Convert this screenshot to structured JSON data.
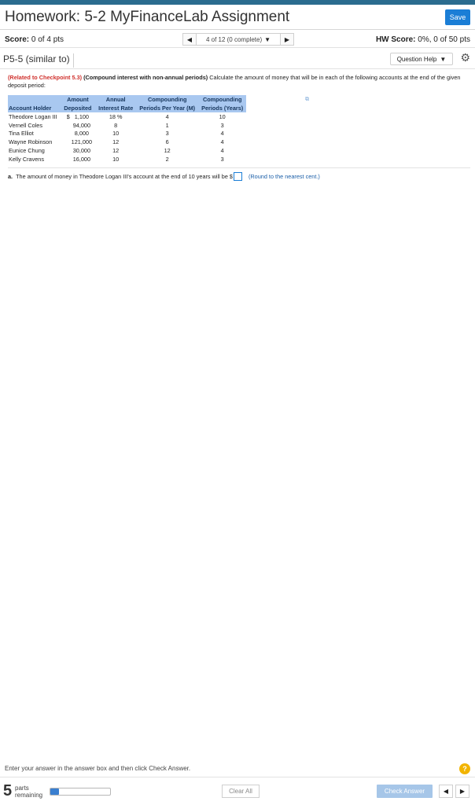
{
  "header": {
    "title": "Homework: 5-2 MyFinanceLab Assignment",
    "save_label": "Save"
  },
  "score_bar": {
    "score_label": "Score:",
    "score_value": "0 of 4 pts",
    "question_selector": "4 of 12 (0 complete)",
    "hw_score_label": "HW Score:",
    "hw_score_value": "0%, 0 of 50 pts"
  },
  "question": {
    "id": "P5-5 (similar to)",
    "help_label": "Question Help",
    "related": "(Related to Checkpoint 5.3)",
    "topic": "(Compound interest with non-annual periods)",
    "prompt": "Calculate the amount of money that will be in each of the following accounts at the end of the given deposit period:",
    "table": {
      "headers": {
        "holder": "Account Holder",
        "amount_1": "Amount",
        "amount_2": "Deposited",
        "rate_1": "Annual",
        "rate_2": "Interest Rate",
        "periods_1": "Compounding",
        "periods_2": "Periods Per Year (M)",
        "years_1": "Compounding",
        "years_2": "Periods (Years)"
      },
      "currency_symbol": "$",
      "rows": [
        {
          "holder": "Theodore Logan III",
          "amount": "1,100",
          "rate": "18 %",
          "m": "4",
          "years": "10"
        },
        {
          "holder": "Vernell Coles",
          "amount": "94,000",
          "rate": "8",
          "m": "1",
          "years": "3"
        },
        {
          "holder": "Tina Elliot",
          "amount": "8,000",
          "rate": "10",
          "m": "3",
          "years": "4"
        },
        {
          "holder": "Wayne Robinson",
          "amount": "121,000",
          "rate": "12",
          "m": "6",
          "years": "4"
        },
        {
          "holder": "Eunice Chung",
          "amount": "30,000",
          "rate": "12",
          "m": "12",
          "years": "4"
        },
        {
          "holder": "Kelly Cravens",
          "amount": "16,000",
          "rate": "10",
          "m": "2",
          "years": "3"
        }
      ]
    },
    "part_a": {
      "label": "a.",
      "text": "The amount of money in Theodore Logan III's account at the end of 10 years will be $",
      "value": "",
      "note": "(Round to the nearest cent.)"
    }
  },
  "footer": {
    "hint": "Enter your answer in the answer box and then click Check Answer.",
    "help_icon": "?",
    "parts_count": "5",
    "parts_label_1": "parts",
    "parts_label_2": "remaining",
    "progress_fraction": 0.15,
    "clear_label": "Clear All",
    "check_label": "Check Answer"
  }
}
